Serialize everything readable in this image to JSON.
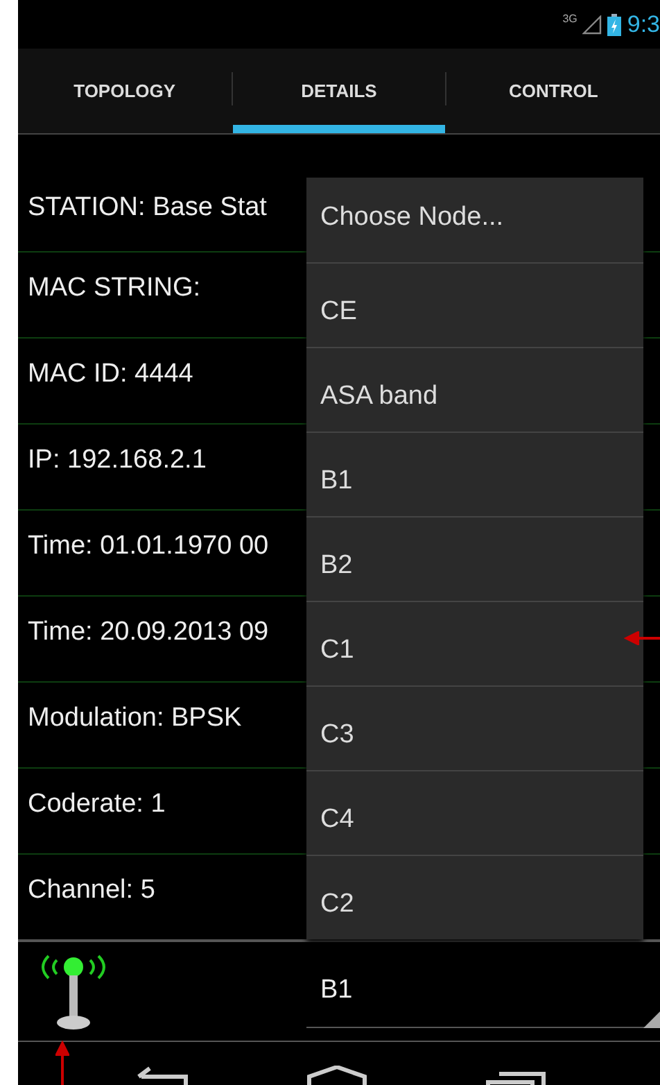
{
  "status_bar": {
    "network": "3G",
    "time": "9:3"
  },
  "tabs": [
    {
      "label": "TOPOLOGY",
      "selected": false
    },
    {
      "label": "DETAILS",
      "selected": true
    },
    {
      "label": "CONTROL",
      "selected": false
    }
  ],
  "details": [
    "STATION: Base Stat",
    "MAC STRING:",
    "MAC ID: 4444",
    "IP: 192.168.2.1",
    "Time: 01.01.1970 00",
    "Time: 20.09.2013 09",
    "Modulation: BPSK",
    "Coderate: 1",
    "Channel: 5"
  ],
  "node_menu": {
    "title": "Choose Node...",
    "items": [
      "CE",
      "ASA band",
      "B1",
      "B2",
      "C1",
      "C3",
      "C4",
      "C2"
    ]
  },
  "node_spinner": {
    "value": "B1"
  }
}
